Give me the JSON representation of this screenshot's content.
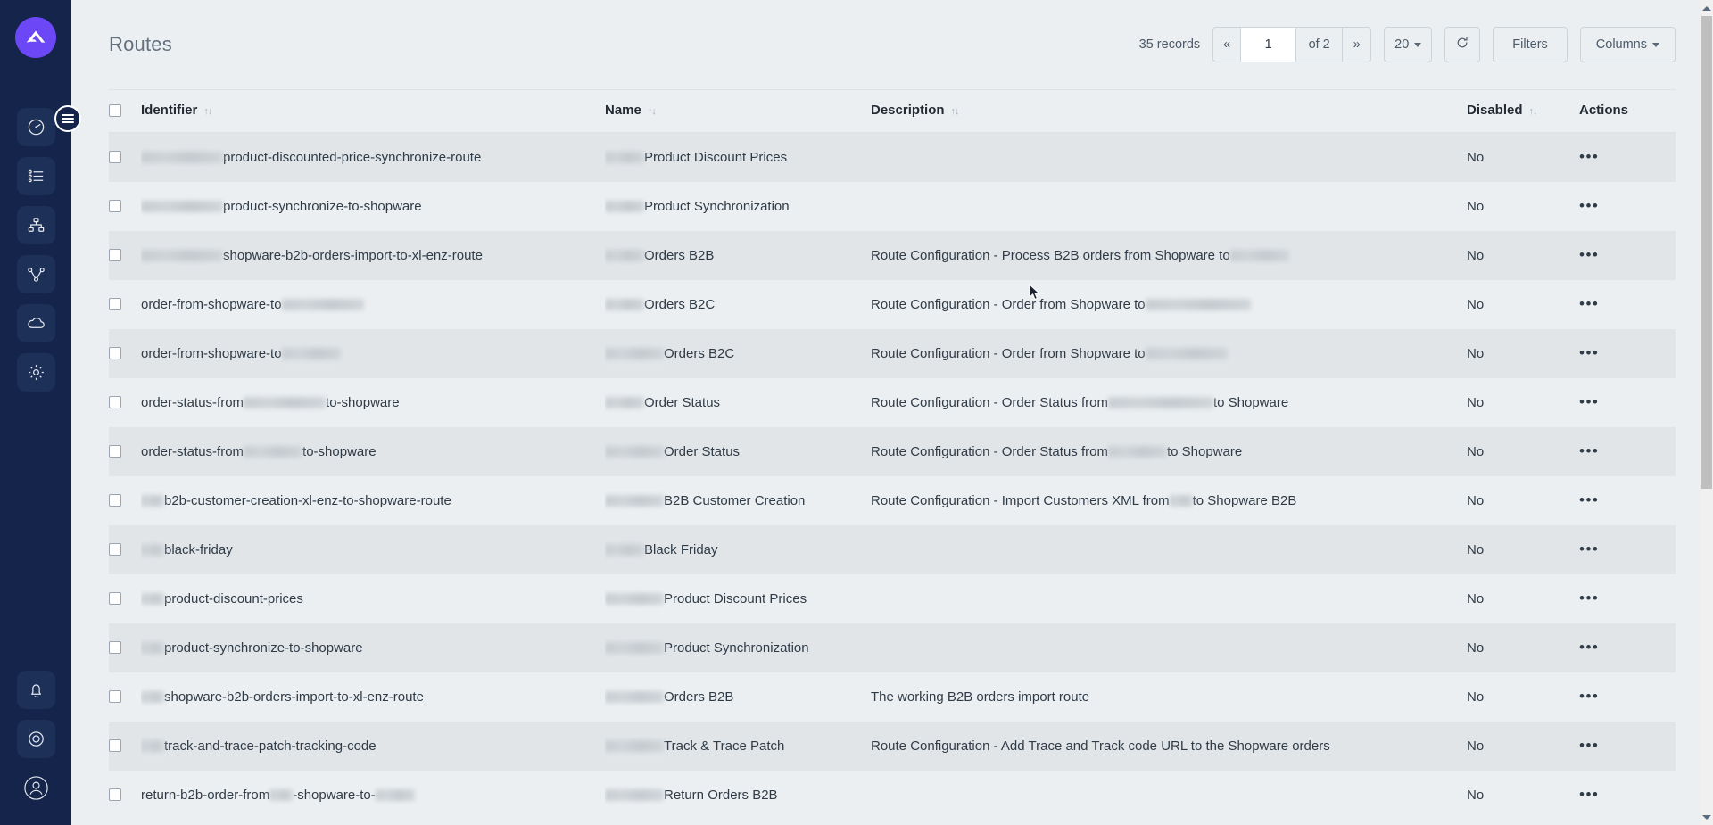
{
  "sidebar": {
    "logo_label": "app-logo",
    "toggle_label": "menu-toggle",
    "items": [
      {
        "id": "dashboard",
        "icon": "gauge-icon"
      },
      {
        "id": "list",
        "icon": "list-icon"
      },
      {
        "id": "organization",
        "icon": "sitemap-icon"
      },
      {
        "id": "routes",
        "icon": "share-nodes-icon"
      },
      {
        "id": "cloud",
        "icon": "cloud-icon"
      },
      {
        "id": "settings",
        "icon": "gear-icon"
      }
    ],
    "bottom_items": [
      {
        "id": "notifications",
        "icon": "bell-icon"
      },
      {
        "id": "help",
        "icon": "lifebuoy-icon"
      },
      {
        "id": "account",
        "icon": "user-circle-icon"
      }
    ]
  },
  "header": {
    "title": "Routes",
    "records_count": "35 records",
    "pagination": {
      "first_label": "«",
      "page_value": "1",
      "of_label": "of 2",
      "last_label": "»"
    },
    "page_size": "20",
    "refresh_icon": "refresh-icon",
    "filters_label": "Filters",
    "columns_label": "Columns"
  },
  "table": {
    "columns": [
      {
        "key": "identifier",
        "label": "Identifier",
        "sortable": true
      },
      {
        "key": "name",
        "label": "Name",
        "sortable": true
      },
      {
        "key": "description",
        "label": "Description",
        "sortable": true
      },
      {
        "key": "disabled",
        "label": "Disabled",
        "sortable": true
      },
      {
        "key": "actions",
        "label": "Actions",
        "sortable": false
      }
    ],
    "sort_glyph": "↑↓",
    "actions_glyph": "•••",
    "rows": [
      {
        "identifier_pre": "r-xl",
        "identifier": "product-discounted-price-synchronize-route",
        "identifier_post": "",
        "name_pre": "r-md",
        "name": "Product Discount Prices",
        "description": "",
        "description_pre": "",
        "description_post": "",
        "disabled": "No"
      },
      {
        "identifier_pre": "r-xl",
        "identifier": "product-synchronize-to-shopware",
        "identifier_post": "",
        "name_pre": "r-md",
        "name": "Product Synchronization",
        "description": "",
        "description_pre": "",
        "description_post": "",
        "disabled": "No"
      },
      {
        "identifier_pre": "r-xl",
        "identifier": "shopware-b2b-orders-import-to-xl-enz-route",
        "identifier_post": "",
        "name_pre": "r-md",
        "name": "Orders B2B",
        "description": "Route Configuration - Process B2B orders from Shopware to",
        "description_pre": "",
        "description_post": "r-lg",
        "disabled": "No"
      },
      {
        "identifier_pre": "",
        "identifier": "order-from-shopware-to",
        "identifier_post": "r-xl",
        "name_pre": "r-md",
        "name": "Orders B2C",
        "description": "Route Configuration - Order from Shopware to",
        "description_pre": "",
        "description_post": "r-xxl",
        "disabled": "No"
      },
      {
        "identifier_pre": "",
        "identifier": "order-from-shopware-to",
        "identifier_post": "r-lg",
        "name_pre": "r-lg",
        "name": "Orders B2C",
        "description": "Route Configuration - Order from Shopware to",
        "description_pre": "",
        "description_post": "r-xl",
        "disabled": "No"
      },
      {
        "identifier_pre": "",
        "identifier": "order-status-from",
        "identifier_post": "r-xl",
        "identifier_tail": "to-shopware",
        "name_pre": "r-md",
        "name": "Order Status",
        "description": "Route Configuration - Order Status from",
        "description_pre": "",
        "description_post": "r-xxl",
        "description_tail": "to Shopware",
        "disabled": "No"
      },
      {
        "identifier_pre": "",
        "identifier": "order-status-from",
        "identifier_post": "r-lg",
        "identifier_tail": "to-shopware",
        "name_pre": "r-lg",
        "name": "Order Status",
        "description": "Route Configuration - Order Status from",
        "description_pre": "",
        "description_post": "r-lg",
        "description_tail": "to Shopware",
        "disabled": "No"
      },
      {
        "identifier_pre": "r-sm",
        "identifier": "b2b-customer-creation-xl-enz-to-shopware-route",
        "identifier_post": "",
        "name_pre": "r-lg",
        "name": "B2B Customer Creation",
        "description": "Route Configuration - Import Customers XML from",
        "description_pre": "",
        "description_post": "r-sm",
        "description_tail": "to Shopware B2B",
        "disabled": "No"
      },
      {
        "identifier_pre": "r-sm",
        "identifier": "black-friday",
        "identifier_post": "",
        "name_pre": "r-md",
        "name": "Black Friday",
        "description": "",
        "description_pre": "",
        "description_post": "",
        "disabled": "No"
      },
      {
        "identifier_pre": "r-sm",
        "identifier": "product-discount-prices",
        "identifier_post": "",
        "name_pre": "r-lg",
        "name": "Product Discount Prices",
        "description": "",
        "description_pre": "",
        "description_post": "",
        "disabled": "No"
      },
      {
        "identifier_pre": "r-sm",
        "identifier": "product-synchronize-to-shopware",
        "identifier_post": "",
        "name_pre": "r-lg",
        "name": "Product Synchronization",
        "description": "",
        "description_pre": "",
        "description_post": "",
        "disabled": "No"
      },
      {
        "identifier_pre": "r-sm",
        "identifier": "shopware-b2b-orders-import-to-xl-enz-route",
        "identifier_post": "",
        "name_pre": "r-lg",
        "name": "Orders B2B",
        "description": "The working B2B orders import route",
        "description_pre": "",
        "description_post": "",
        "disabled": "No"
      },
      {
        "identifier_pre": "r-sm",
        "identifier": "track-and-trace-patch-tracking-code",
        "identifier_post": "",
        "name_pre": "r-lg",
        "name": "Track & Trace Patch",
        "description": "Route Configuration - Add Trace and Track code URL to the Shopware orders",
        "description_pre": "",
        "description_post": "",
        "disabled": "No"
      },
      {
        "identifier_pre": "",
        "identifier": "return-b2b-order-from",
        "identifier_post": "r-sm",
        "identifier_tail": "-shopware-to-",
        "identifier_post2": "r-md",
        "name_pre": "r-lg",
        "name": "Return Orders B2B",
        "description": "",
        "description_pre": "",
        "description_post": "",
        "disabled": "No"
      }
    ]
  },
  "scrollbar": {
    "up_icon": "triangle-up-icon",
    "down_icon": "triangle-down-icon"
  }
}
